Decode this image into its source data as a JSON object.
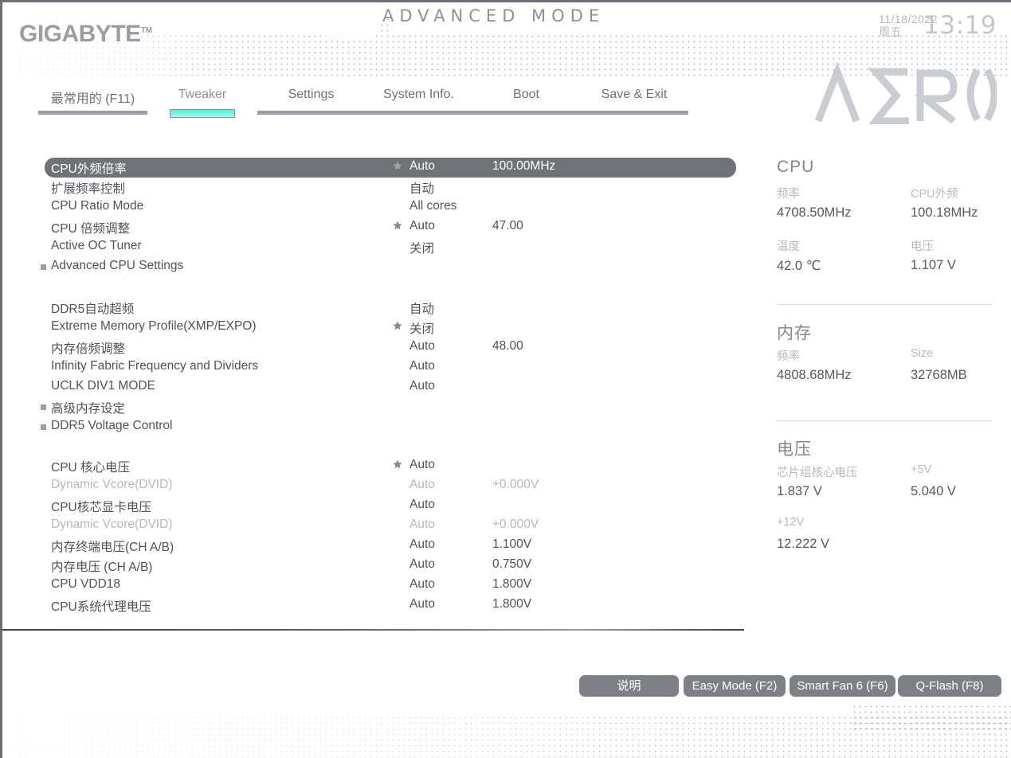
{
  "brand": {
    "logo_text": "GIGABYTE",
    "trademark": "TM",
    "mode_title": "ADVANCED MODE",
    "series_logo": "AERO"
  },
  "header": {
    "date": "11/18/2022",
    "weekday": "周五",
    "time": "13:19"
  },
  "nav": {
    "tabs": [
      {
        "label": "最常用的 (F11)",
        "active": false
      },
      {
        "label": "Tweaker",
        "active": true
      },
      {
        "label": "Settings",
        "active": false
      },
      {
        "label": "System Info.",
        "active": false
      },
      {
        "label": "Boot",
        "active": false
      },
      {
        "label": "Save & Exit",
        "active": false
      }
    ]
  },
  "settings": {
    "groups": [
      {
        "rows": [
          {
            "name": "CPU外频倍率",
            "star": true,
            "value": "Auto",
            "value2": "100.00MHz",
            "selected": true,
            "dim": false,
            "submenu": false
          },
          {
            "name": "扩展频率控制",
            "star": false,
            "value": "自动",
            "value2": "",
            "selected": false,
            "dim": false,
            "submenu": false
          },
          {
            "name": "CPU Ratio Mode",
            "star": false,
            "value": "All cores",
            "value2": "",
            "selected": false,
            "dim": false,
            "submenu": false
          },
          {
            "name": "CPU 倍频调整",
            "star": true,
            "value": "Auto",
            "value2": "47.00",
            "selected": false,
            "dim": false,
            "submenu": false
          },
          {
            "name": "Active OC Tuner",
            "star": false,
            "value": "关闭",
            "value2": "",
            "selected": false,
            "dim": false,
            "submenu": false
          },
          {
            "name": "Advanced CPU Settings",
            "star": false,
            "value": "",
            "value2": "",
            "selected": false,
            "dim": false,
            "submenu": true
          }
        ]
      },
      {
        "rows": [
          {
            "name": "DDR5自动超频",
            "star": false,
            "value": "自动",
            "value2": "",
            "selected": false,
            "dim": false,
            "submenu": false
          },
          {
            "name": "Extreme Memory Profile(XMP/EXPO)",
            "star": true,
            "value": "关闭",
            "value2": "",
            "selected": false,
            "dim": false,
            "submenu": false
          },
          {
            "name": "内存倍频调整",
            "star": false,
            "value": "Auto",
            "value2": "48.00",
            "selected": false,
            "dim": false,
            "submenu": false
          },
          {
            "name": "Infinity Fabric Frequency and Dividers",
            "star": false,
            "value": "Auto",
            "value2": "",
            "selected": false,
            "dim": false,
            "submenu": false
          },
          {
            "name": "UCLK DIV1 MODE",
            "star": false,
            "value": "Auto",
            "value2": "",
            "selected": false,
            "dim": false,
            "submenu": false
          },
          {
            "name": "高级内存设定",
            "star": false,
            "value": "",
            "value2": "",
            "selected": false,
            "dim": false,
            "submenu": true
          },
          {
            "name": "DDR5 Voltage Control",
            "star": false,
            "value": "",
            "value2": "",
            "selected": false,
            "dim": false,
            "submenu": true
          }
        ]
      },
      {
        "rows": [
          {
            "name": "CPU 核心电压",
            "star": true,
            "value": "Auto",
            "value2": "",
            "selected": false,
            "dim": false,
            "submenu": false
          },
          {
            "name": "Dynamic Vcore(DVID)",
            "star": false,
            "value": "Auto",
            "value2": "+0.000V",
            "selected": false,
            "dim": true,
            "submenu": false
          },
          {
            "name": "CPU核芯显卡电压",
            "star": false,
            "value": "Auto",
            "value2": "",
            "selected": false,
            "dim": false,
            "submenu": false
          },
          {
            "name": "Dynamic Vcore(DVID)",
            "star": false,
            "value": "Auto",
            "value2": "+0.000V",
            "selected": false,
            "dim": true,
            "submenu": false
          },
          {
            "name": "内存终端电压(CH A/B)",
            "star": false,
            "value": "Auto",
            "value2": "1.100V",
            "selected": false,
            "dim": false,
            "submenu": false
          },
          {
            "name": "内存电压        (CH A/B)",
            "star": false,
            "value": "Auto",
            "value2": "0.750V",
            "selected": false,
            "dim": false,
            "submenu": false
          },
          {
            "name": "CPU VDD18",
            "star": false,
            "value": "Auto",
            "value2": "1.800V",
            "selected": false,
            "dim": false,
            "submenu": false
          },
          {
            "name": "CPU系统代理电压",
            "star": false,
            "value": "Auto",
            "value2": "1.800V",
            "selected": false,
            "dim": false,
            "submenu": false
          }
        ]
      }
    ]
  },
  "sidebar": {
    "sections": [
      {
        "title": "CPU",
        "fields": [
          {
            "label": "频率",
            "value": "4708.50MHz"
          },
          {
            "label": "CPU外频",
            "value": "100.18MHz"
          },
          {
            "label": "温度",
            "value": " 42.0 ℃"
          },
          {
            "label": "电压",
            "value": "1.107 V"
          }
        ]
      },
      {
        "title": "内存",
        "fields": [
          {
            "label": "频率",
            "value": "4808.68MHz"
          },
          {
            "label": "Size",
            "value": "32768MB"
          }
        ]
      },
      {
        "title": "电压",
        "fields": [
          {
            "label": "芯片组核心电压",
            "value": "1.837 V"
          },
          {
            "label": "+5V",
            "value": "5.040 V"
          },
          {
            "label": "+12V",
            "value": "12.222 V"
          }
        ]
      }
    ]
  },
  "buttons": [
    {
      "label": "说明"
    },
    {
      "label": "Easy Mode (F2)"
    },
    {
      "label": "Smart Fan 6 (F6)"
    },
    {
      "label": "Q-Flash (F8)"
    }
  ]
}
